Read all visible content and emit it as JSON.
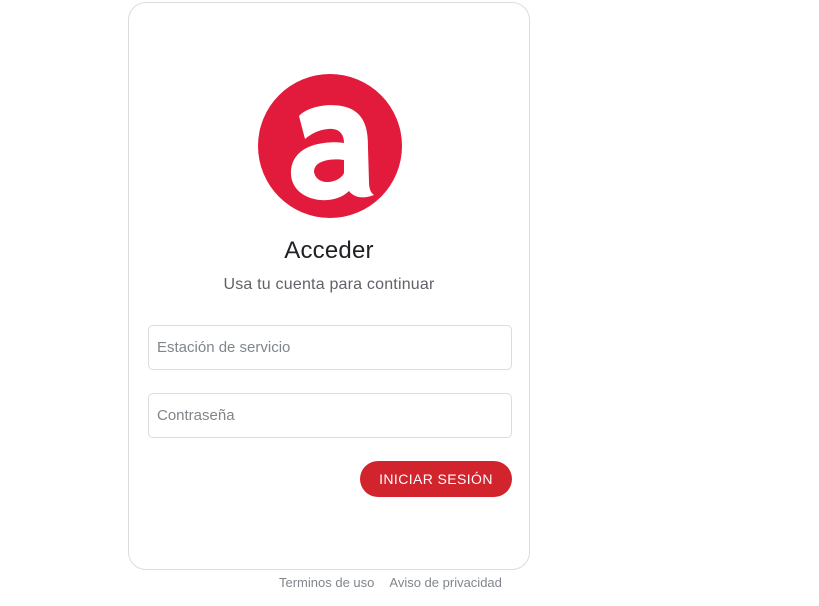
{
  "colors": {
    "brand_red": "#e21a3b",
    "button_red": "#d1242d",
    "card_border": "#dadce0",
    "muted_text": "#80868b"
  },
  "logo": {
    "icon": "brand-a-logo-icon",
    "letter": "a"
  },
  "login": {
    "title": "Acceder",
    "subtitle": "Usa tu cuenta para continuar",
    "station_placeholder": "Estación de servicio",
    "station_value": "",
    "password_placeholder": "Contraseña",
    "password_value": "",
    "submit_label": "INICIAR SESIÓN"
  },
  "footer": {
    "terms_label": "Terminos de uso",
    "privacy_label": "Aviso de privacidad"
  }
}
